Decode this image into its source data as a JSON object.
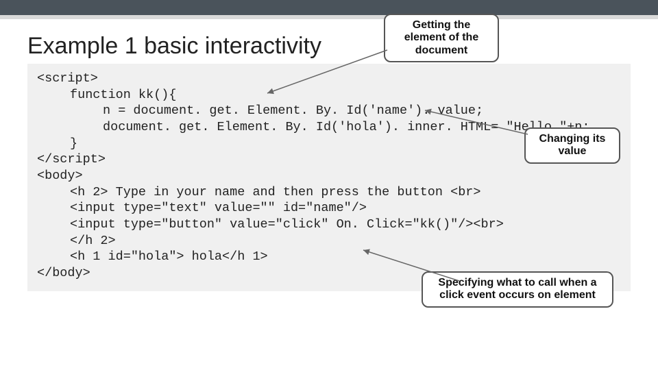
{
  "title": "Example 1 basic interactivity",
  "code": {
    "l1": "<script>",
    "l2": "function kk(){",
    "l3": "n = document. get. Element. By. Id('name'). value;",
    "l4": "document. get. Element. By. Id('hola'). inner. HTML= \"Hello \"+n;",
    "l5": "}",
    "l6": "</script>",
    "l7": "",
    "l8": "<body>",
    "l9": "<h 2> Type in your name and then press the button <br>",
    "l10": "<input type=\"text\" value=\"\" id=\"name\"/>",
    "l11": "<input type=\"button\" value=\"click\" On. Click=\"kk()\"/><br>",
    "l12": "</h 2>",
    "l13": "<h 1 id=\"hola\"> hola</h 1>",
    "l14": "</body>"
  },
  "callouts": {
    "c1": "Getting the element of the document",
    "c2": "Changing its value",
    "c3": "Specifying what to call when a click event occurs on element"
  }
}
